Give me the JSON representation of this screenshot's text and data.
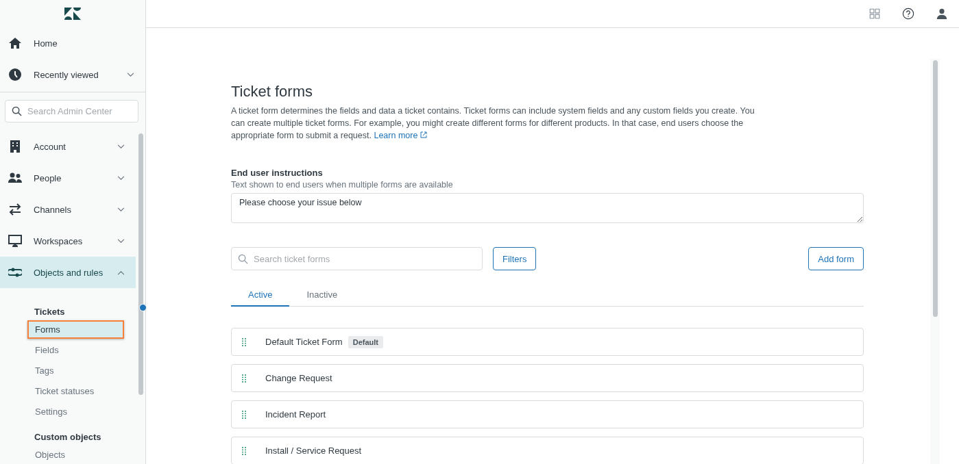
{
  "sidebar": {
    "top_items": [
      {
        "label": "Home"
      },
      {
        "label": "Recently viewed",
        "expanded": false
      }
    ],
    "search": {
      "placeholder": "Search Admin Center"
    },
    "sections": [
      {
        "label": "Account",
        "expanded": false,
        "selected": false
      },
      {
        "label": "People",
        "expanded": false,
        "selected": false
      },
      {
        "label": "Channels",
        "expanded": false,
        "selected": false
      },
      {
        "label": "Workspaces",
        "expanded": false,
        "selected": false
      },
      {
        "label": "Objects and rules",
        "expanded": true,
        "selected": true
      }
    ],
    "groups": [
      {
        "heading": "Tickets",
        "items": [
          {
            "label": "Forms",
            "selected": true
          },
          {
            "label": "Fields",
            "selected": false
          },
          {
            "label": "Tags",
            "selected": false
          },
          {
            "label": "Ticket statuses",
            "selected": false
          },
          {
            "label": "Settings",
            "selected": false
          }
        ]
      },
      {
        "heading": "Custom objects",
        "items": [
          {
            "label": "Objects",
            "selected": false
          }
        ]
      }
    ]
  },
  "page": {
    "title": "Ticket forms",
    "description": "A ticket form determines the fields and data a ticket contains. Ticket forms can include system fields and any custom fields you create. You can create multiple ticket forms. For example, you might create different forms for different products. In that case, end users choose the appropriate form to submit a request.",
    "learn_more": "Learn more",
    "instructions": {
      "label": "End user instructions",
      "hint": "Text shown to end users when multiple forms are available",
      "value": "Please choose your issue below"
    },
    "search": {
      "placeholder": "Search ticket forms"
    },
    "filters_button": "Filters",
    "add_button": "Add form",
    "tabs": [
      {
        "label": "Active",
        "selected": true
      },
      {
        "label": "Inactive",
        "selected": false
      }
    ],
    "forms": [
      {
        "name": "Default Ticket Form",
        "badge": "Default"
      },
      {
        "name": "Change Request"
      },
      {
        "name": "Incident Report"
      },
      {
        "name": "Install / Service Request"
      }
    ]
  }
}
